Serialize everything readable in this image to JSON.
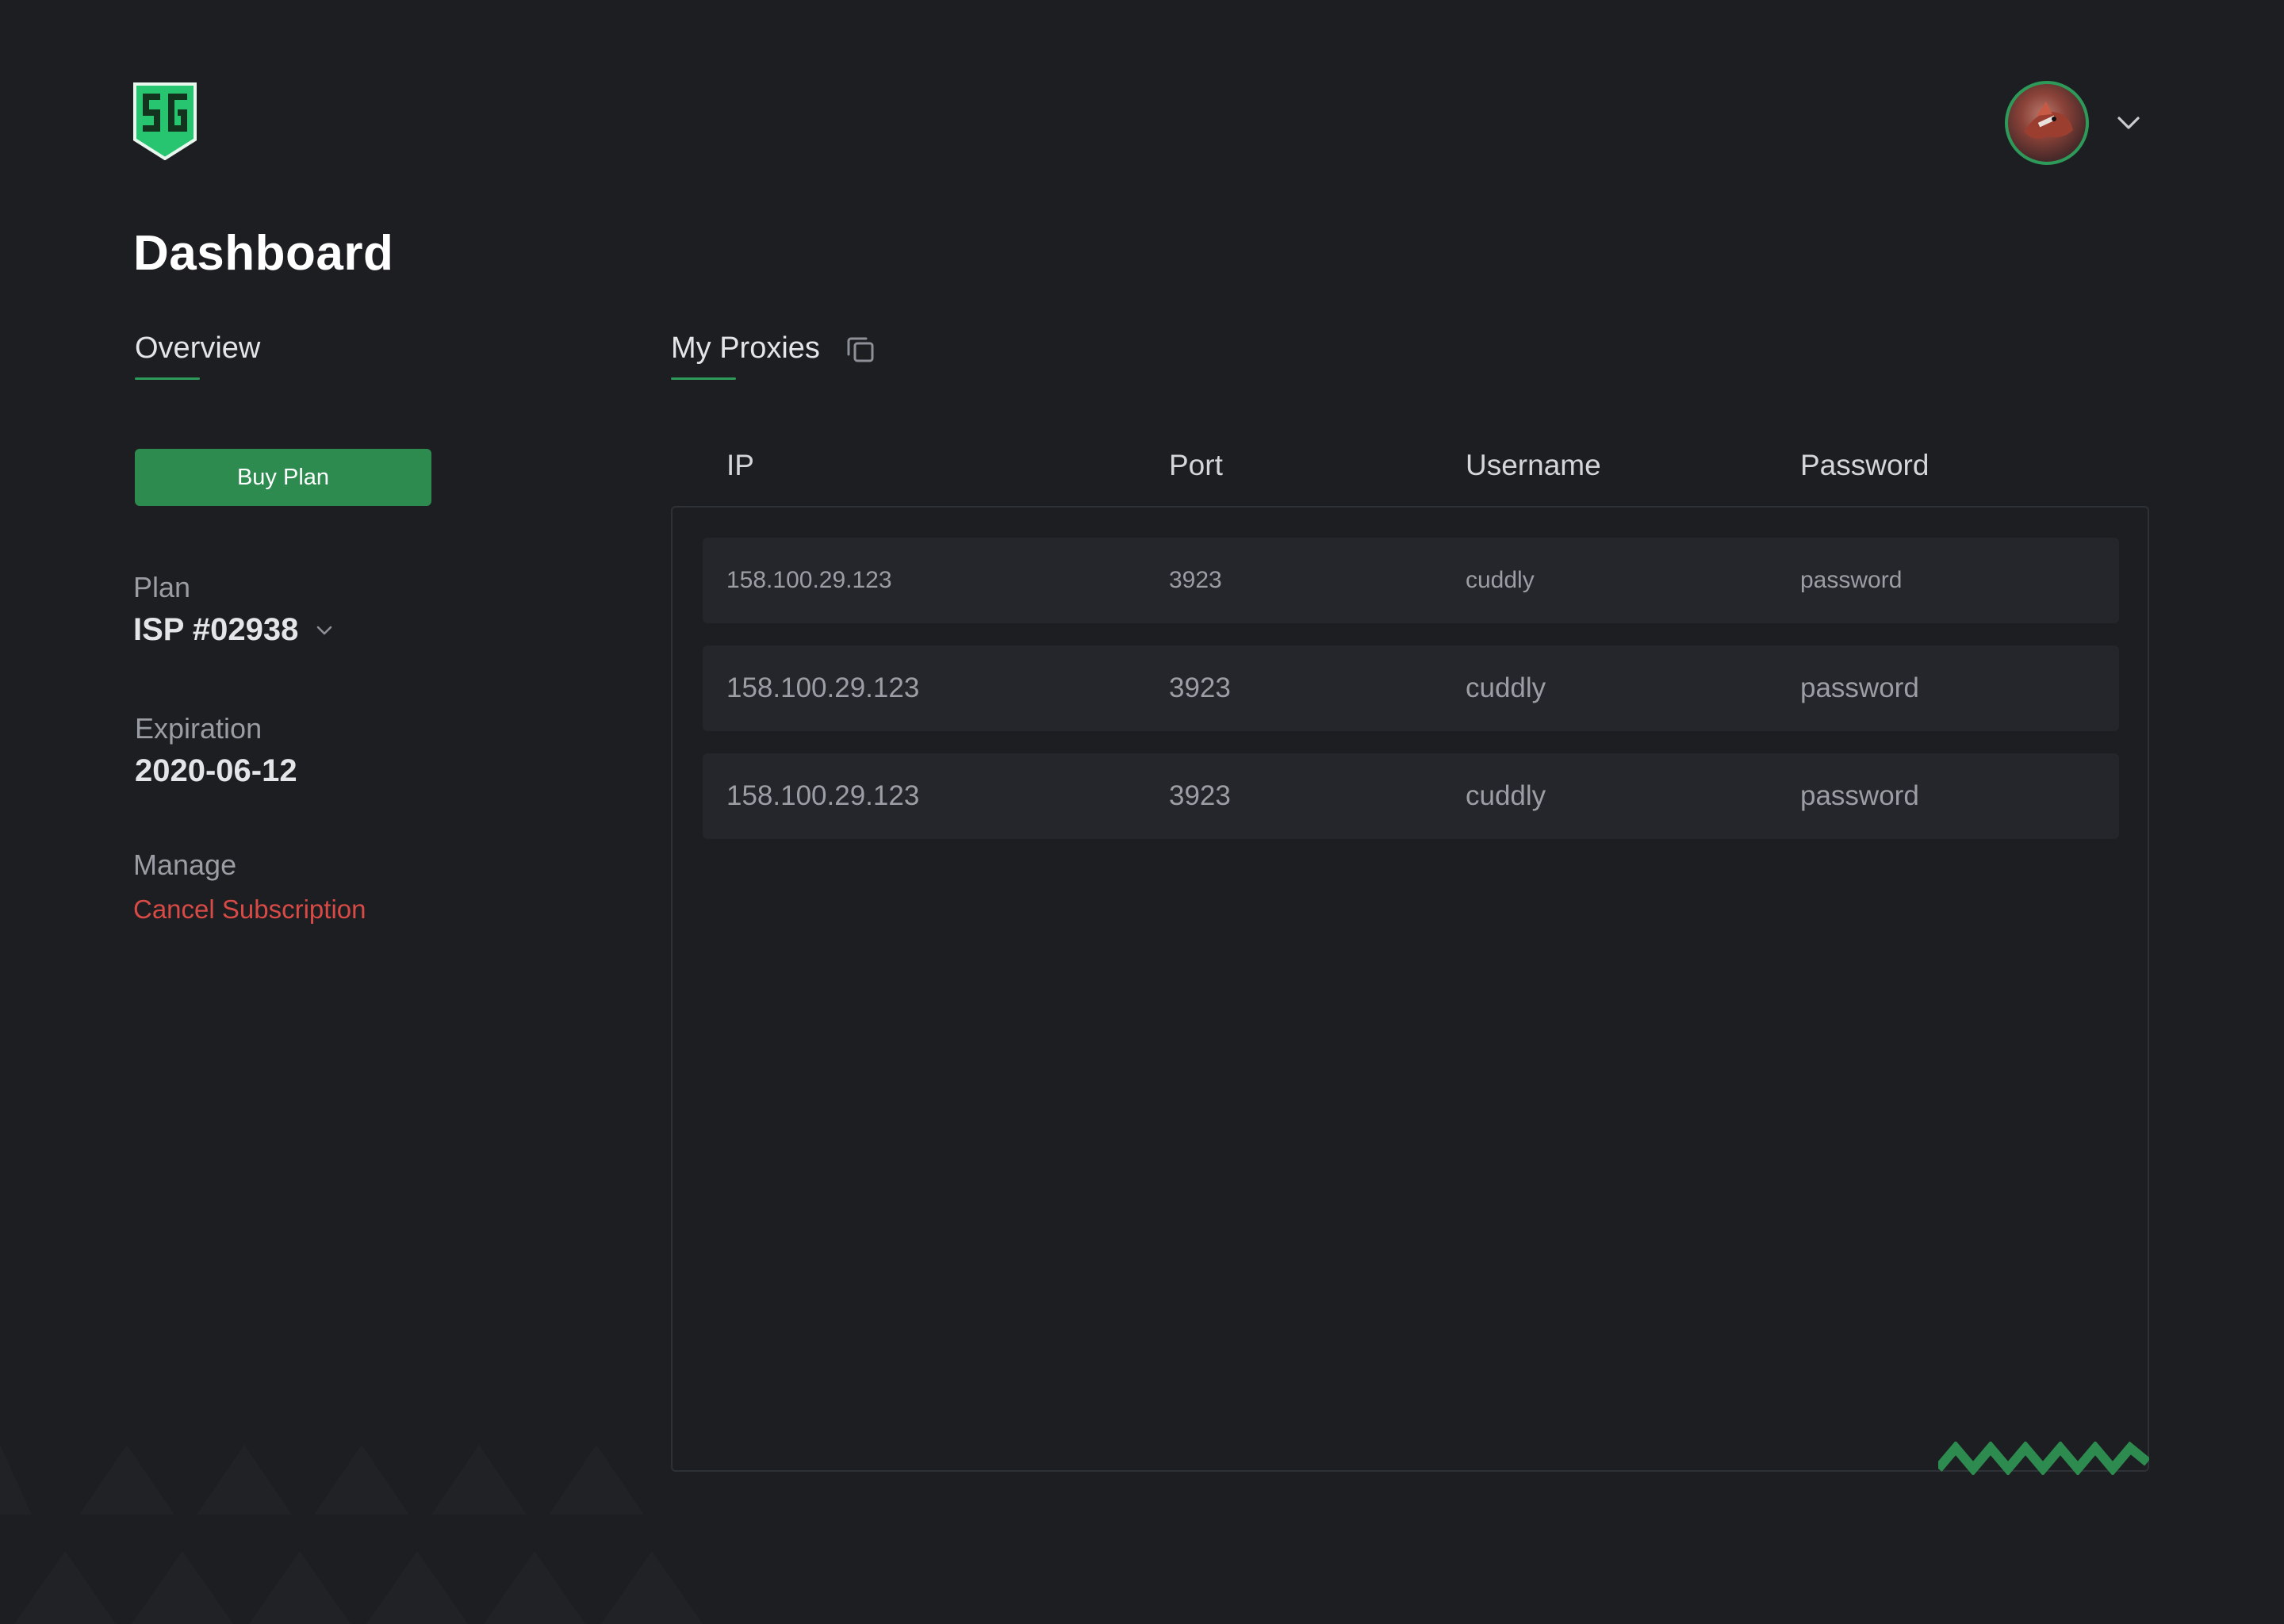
{
  "header": {
    "logo_alt": "SG",
    "avatar_alt": "User avatar"
  },
  "page": {
    "title": "Dashboard"
  },
  "tabs": {
    "overview": "Overview",
    "proxies": "My Proxies"
  },
  "sidebar": {
    "buy_button": "Buy Plan",
    "plan_label": "Plan",
    "plan_value": "ISP #02938",
    "expiration_label": "Expiration",
    "expiration_value": "2020-06-12",
    "manage_label": "Manage",
    "cancel_link": "Cancel Subscription"
  },
  "table": {
    "columns": [
      "IP",
      "Port",
      "Username",
      "Password"
    ],
    "rows": [
      {
        "ip": "158.100.29.123",
        "port": "3923",
        "username": "cuddly",
        "password": "password"
      },
      {
        "ip": "158.100.29.123",
        "port": "3923",
        "username": "cuddly",
        "password": "password"
      },
      {
        "ip": "158.100.29.123",
        "port": "3923",
        "username": "cuddly",
        "password": "password"
      }
    ]
  },
  "colors": {
    "background": "#1c1e22",
    "accent_green": "#2e8b4f",
    "danger_red": "#d84a45",
    "row_bg": "#24262b"
  },
  "icons": {
    "logo": "sg-shield-logo",
    "user_menu": "chevron-down-icon",
    "plan_select": "chevron-down-icon",
    "copy": "copy-icon"
  }
}
